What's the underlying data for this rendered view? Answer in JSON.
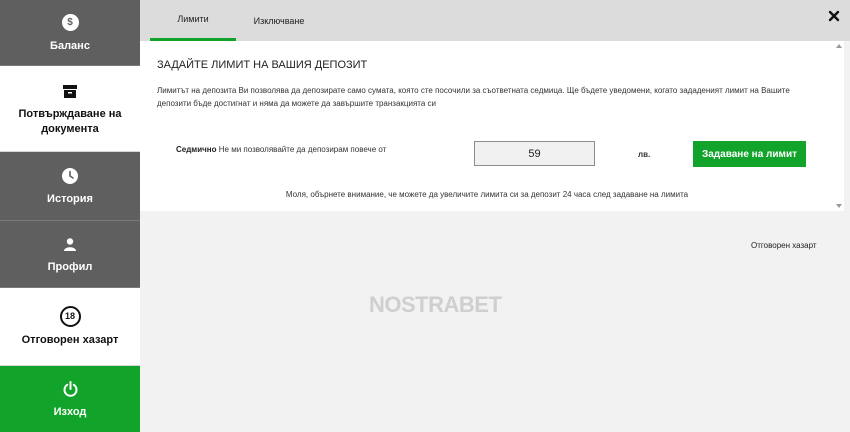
{
  "sidebar": {
    "items": [
      {
        "label": "Баланс",
        "icon": "dollar-icon",
        "icon_glyph": "$"
      },
      {
        "label": "Потвърждаване на документа",
        "icon": "archive-box-icon"
      },
      {
        "label": "История",
        "icon": "clock-icon"
      },
      {
        "label": "Профил",
        "icon": "user-icon"
      },
      {
        "label": "Отговорен хазарт",
        "icon": "age-18-icon",
        "icon_glyph": "18"
      },
      {
        "label": "Изход",
        "icon": "power-icon"
      }
    ]
  },
  "tabs": [
    {
      "label": "Лимити",
      "active": true
    },
    {
      "label": "Изключване",
      "active": false
    }
  ],
  "limits": {
    "heading": "ЗАДАЙТЕ ЛИМИТ НА ВАШИЯ ДЕПОЗИТ",
    "description": "Лимитът на депозита Ви позволява да депозирате само сумата, която сте посочили за съответната седмица. Ще бъдете уведомени, когато зададеният лимит на Вашите депозити бъде достигнат и няма да можете да завършите транзакцията си",
    "period_label": "Седмично",
    "limit_text": "Не ми позволявайте да депозирам повече от",
    "limit_value": "59",
    "currency": "лв.",
    "set_button": "Задаване на лимит",
    "note": "Моля, обърнете внимание, че можете да увеличите лимита си за депозит 24 часа след задаване на лимита"
  },
  "responsible_gambling_link": "Отговорен хазарт",
  "watermark": "NOSTRABET",
  "colors": {
    "accent_green": "#12a32b",
    "sidebar_dark": "#5f5f5f"
  }
}
